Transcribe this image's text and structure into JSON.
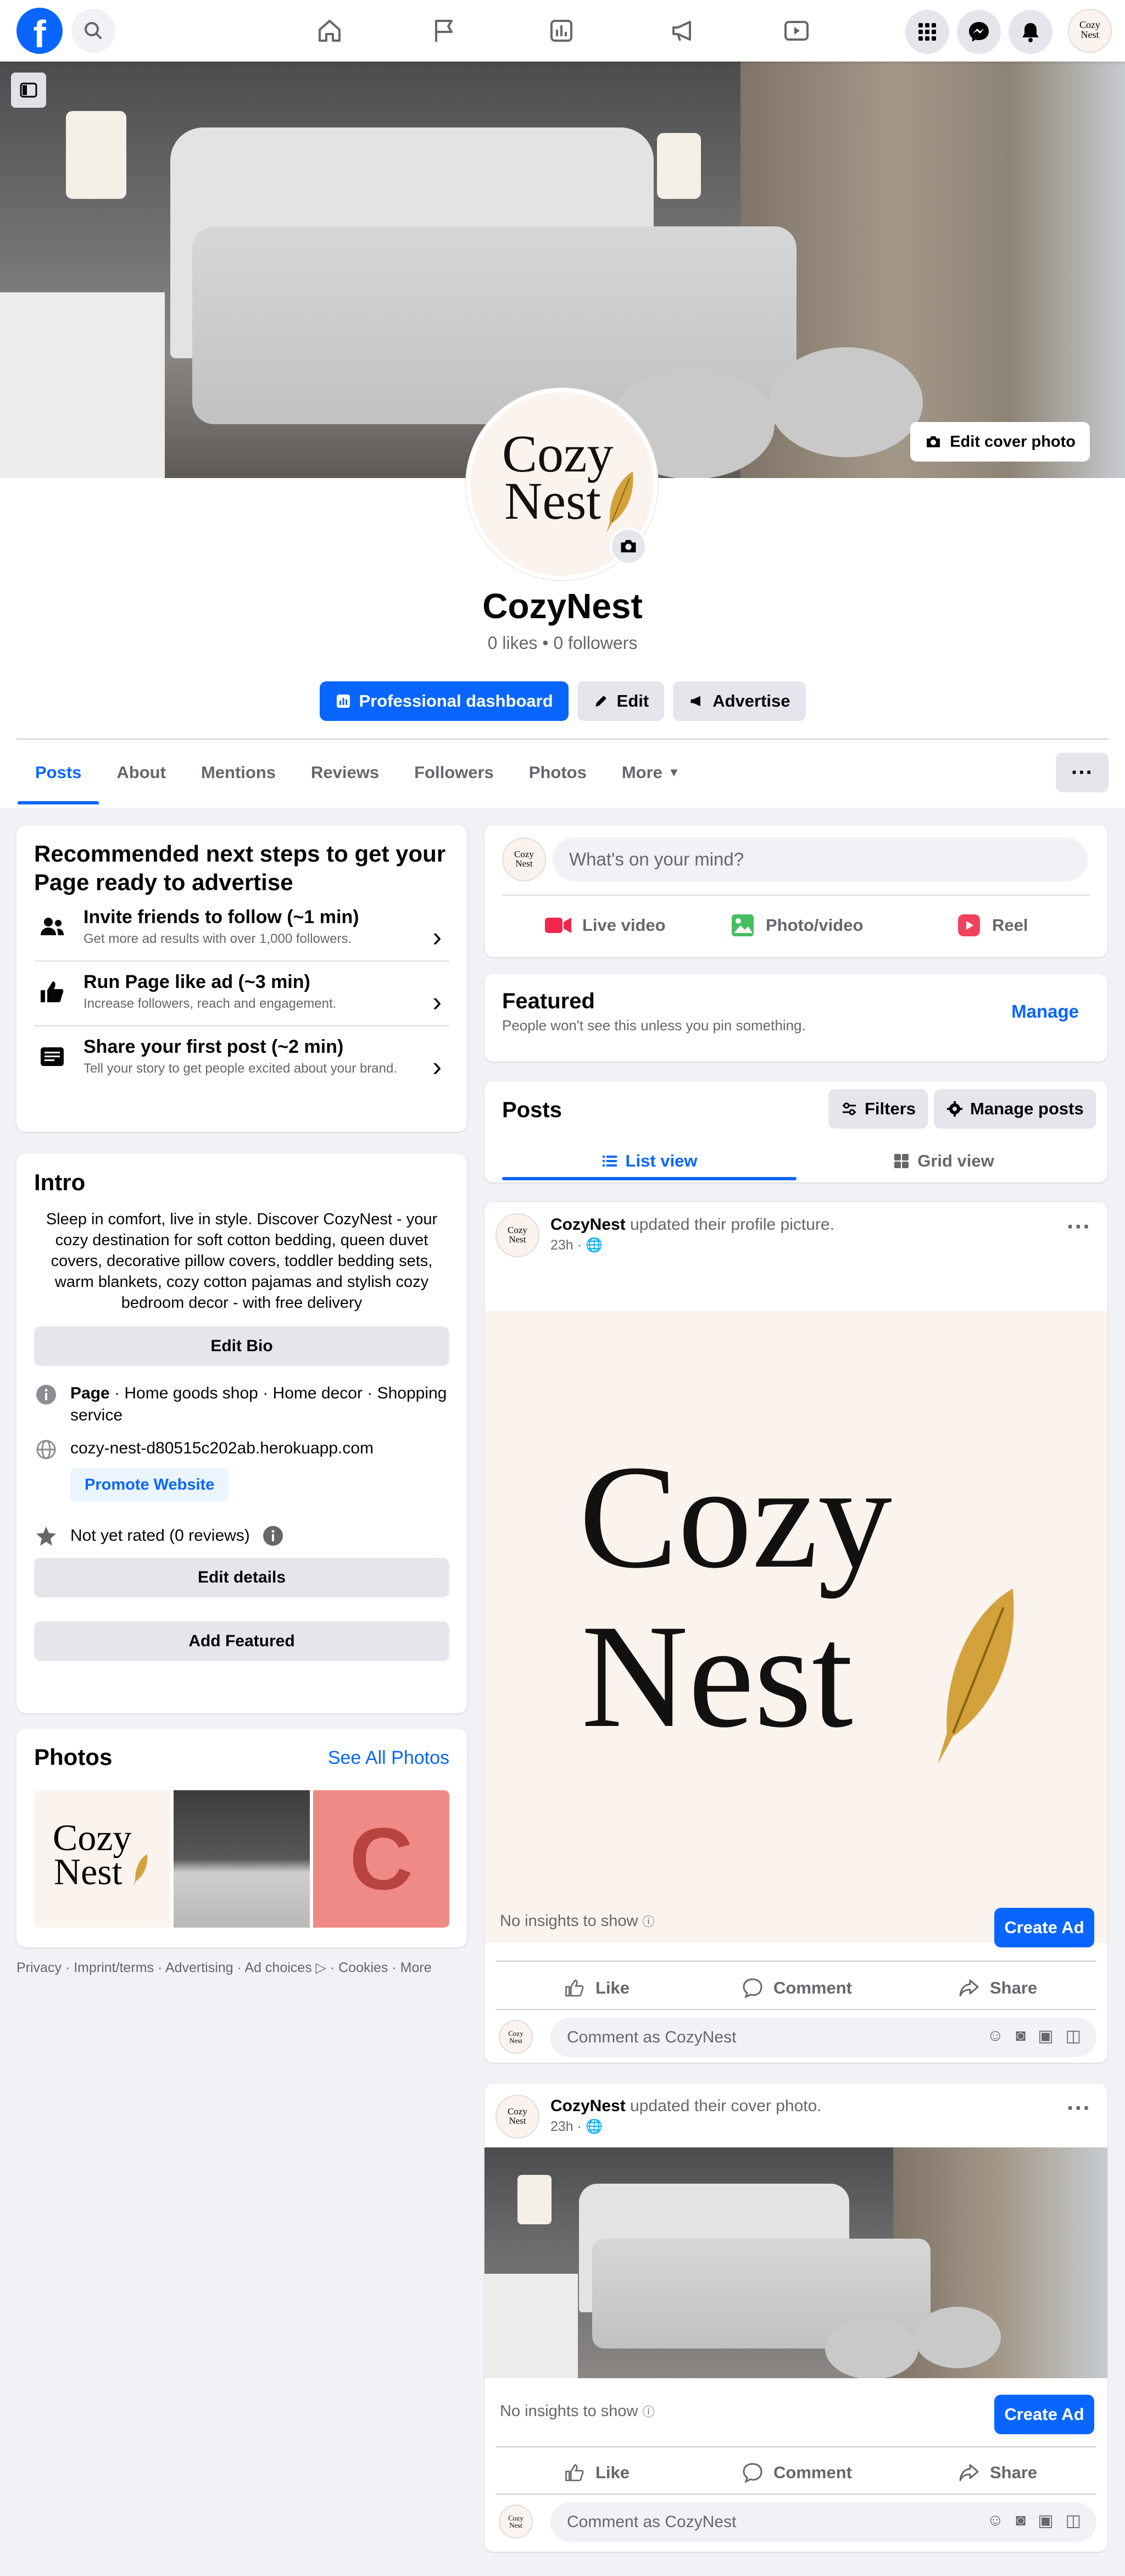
{
  "nav": {
    "logo": "f",
    "account_avatar": [
      "Cozy",
      "Nest"
    ]
  },
  "cover": {
    "edit_cover_label": "Edit cover photo"
  },
  "profile": {
    "avatar_line1": "Cozy",
    "avatar_line2": "Nest",
    "name": "CozyNest",
    "stats": "0 likes • 0 followers",
    "buttons": {
      "dashboard": "Professional dashboard",
      "edit": "Edit",
      "advertise": "Advertise"
    },
    "tabs": [
      "Posts",
      "About",
      "Mentions",
      "Reviews",
      "Followers",
      "Photos",
      "More"
    ],
    "active_tab": "Posts"
  },
  "steps": {
    "title": "Recommended next steps to get your Page ready to advertise",
    "items": [
      {
        "title": "Invite friends to follow (~1 min)",
        "sub": "Get more ad results with over 1,000 followers."
      },
      {
        "title": "Run Page like ad (~3 min)",
        "sub": "Increase followers, reach and engagement."
      },
      {
        "title": "Share your first post (~2 min)",
        "sub": "Tell your story to get people excited about your brand."
      }
    ]
  },
  "intro": {
    "title": "Intro",
    "bio": "Sleep in comfort, live in style. Discover CozyNest - your cozy destination for soft cotton bedding, queen duvet covers, decorative pillow covers, toddler bedding sets, warm blankets, cozy cotton pajamas and stylish cozy bedroom decor - with free delivery",
    "edit_bio": "Edit Bio",
    "page_label": "Page",
    "categories": " · Home goods shop · Home decor · Shopping service",
    "website": "cozy-nest-d80515c202ab.herokuapp.com",
    "promote": "Promote Website",
    "rating": "Not yet rated (0 reviews)",
    "edit_details": "Edit details",
    "add_featured": "Add Featured"
  },
  "photos": {
    "title": "Photos",
    "see_all": "See All Photos",
    "thumb1": [
      "Cozy",
      "Nest"
    ],
    "thumb3": "C"
  },
  "footer": {
    "links": [
      "Privacy",
      "Imprint/terms",
      "Advertising",
      "Ad choices",
      "Cookies",
      "More"
    ]
  },
  "composer": {
    "placeholder": "What's on your mind?",
    "live": "Live video",
    "photo": "Photo/video",
    "reel": "Reel"
  },
  "featured": {
    "title": "Featured",
    "sub": "People won't see this unless you pin something.",
    "manage": "Manage"
  },
  "posts_section": {
    "title": "Posts",
    "filters": "Filters",
    "manage": "Manage posts",
    "list_view": "List view",
    "grid_view": "Grid view"
  },
  "posts": [
    {
      "author": "CozyNest",
      "action": " updated their profile picture.",
      "time": "23h ·",
      "image_text": [
        "Cozy",
        "Nest"
      ],
      "insights": "No insights to show",
      "create_ad": "Create Ad",
      "like": "Like",
      "comment": "Comment",
      "share": "Share",
      "comment_placeholder": "Comment as CozyNest"
    },
    {
      "author": "CozyNest",
      "action": " updated their cover photo.",
      "time": "23h ·",
      "insights": "No insights to show",
      "create_ad": "Create Ad",
      "like": "Like",
      "comment": "Comment",
      "share": "Share",
      "comment_placeholder": "Comment as CozyNest"
    }
  ],
  "colors": {
    "brand_blue": "#0866ff",
    "page_bg": "#f0f2f5",
    "secondary_text": "#65676b",
    "button_grey": "#e4e6eb",
    "logo_bg": "#fbf3ee",
    "photo_c_bg": "#f08a86",
    "photo_c_fg": "#b8433f"
  }
}
